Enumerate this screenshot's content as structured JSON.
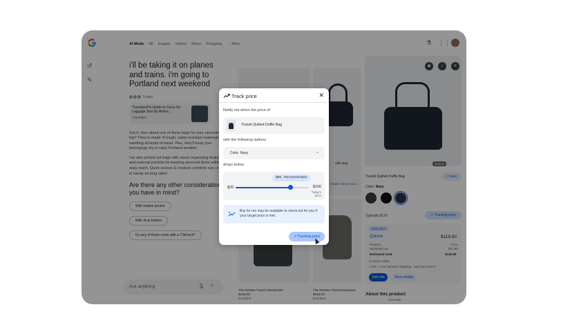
{
  "topbar": {
    "logo": "G",
    "tabs": [
      "AI Mode",
      "All",
      "Images",
      "Videos",
      "News",
      "Shopping",
      "⋮ More"
    ],
    "active_tab": "AI Mode"
  },
  "chat": {
    "headline": "i'll be taking it on planes and trains. i'm going to Portland next weekend",
    "sites_label": "9 sites",
    "source_title": "Travelpro®'s Guide to Carry-On Luggage Size By Airline...",
    "source_name": "Travelpro",
    "paragraph1": "Got it. How about one of these bags for your upcoming trip? They're made of tough, water-resistant materials for handling all kinds of travel. Plus, they'll keep your belongings dry in rainy Portland weather.",
    "paragraph2": "I've also picked out bags with clever organizing features and external pockets for keeping personal items within easy reach. Quick access & creature comforts can come in handy on long rides!",
    "question": "Are there any other considerations you have in mind?",
    "chips": [
      "With hidden pocket",
      "With drop bottom",
      "Do any of these come with a TSA lock?"
    ],
    "ask_placeholder": "Ask anything"
  },
  "grid": {
    "item_a_label": "uffle Bag",
    "item_a_snip": "shable clever yout",
    "item_c_title": "The ReNew Transit Weekender",
    "item_c_price": "$118.00",
    "item_c_store": "Everlane",
    "item_d_title": "The ReNew Transit Backpack",
    "item_d_price": "$118.00",
    "item_d_store": "Everlane"
  },
  "right_panel": {
    "image_badge": "Quince",
    "product_name": "Transit Quilted Duffle Bag",
    "save_label": "Save",
    "color_label": "Color:",
    "color_value": "Navy",
    "typically_label": "Typically $120",
    "tracking_label": "Tracking price",
    "best_price_label": "Best price",
    "store": "Quince",
    "price": "$119.90",
    "delivery_label": "Delivery",
    "delivery_value": "Free",
    "tax_label": "Estimated tax",
    "tax_value": "$10.95",
    "total_label": "Estimated total",
    "total_value": "$130.85",
    "stock": "In stock online",
    "rating": "4.6/5 · Free standard shipping · 365-day returns",
    "visit_label": "Visit site",
    "more_label": "More details",
    "about_label": "About this product",
    "about_sub": "Generate"
  },
  "modal": {
    "title": "Track price",
    "notify_label": "Notify me when the price of",
    "product_name": "Transit Quilted Duffle Bag",
    "options_label": "with the following options",
    "color_option": "Color: Navy",
    "drops_label": "drops below",
    "recommended": "$95 · Recommended",
    "min_price": "$20",
    "max_price": "$100",
    "today_label": "Today's price",
    "slider_fraction": 0.75,
    "buy_text": "Buy for me may be available to check out for you if your target price is met.",
    "tracking_button": "Tracking price"
  },
  "colors": {
    "accent": "#0b57d0",
    "accent_light": "#d3e3fd",
    "navy": "#1f2633"
  }
}
